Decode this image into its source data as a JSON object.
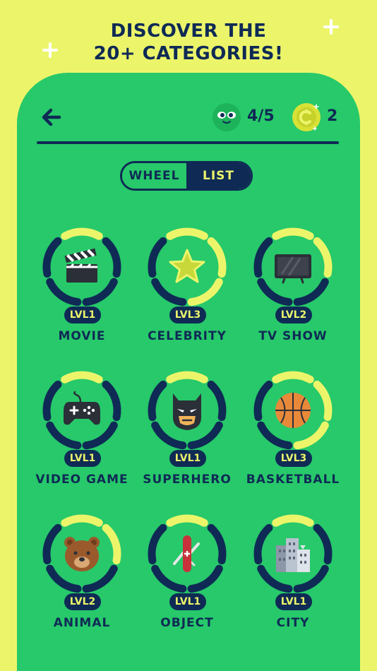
{
  "headline": {
    "line1": "DISCOVER THE",
    "line2": "20+ CATEGORIES!"
  },
  "header": {
    "progress": "4/5",
    "coins": "2"
  },
  "view_toggle": {
    "wheel_label": "WHEEL",
    "list_label": "LIST",
    "selected": "LIST"
  },
  "colors": {
    "background": "#ecf56a",
    "panel": "#27c96a",
    "navy": "#0f2a55",
    "ring_filled": "#ecf56a"
  },
  "categories": [
    {
      "name": "MOVIE",
      "level": "LVL1",
      "icon": "clapperboard-icon",
      "filled_segments": 1
    },
    {
      "name": "CELEBRITY",
      "level": "LVL3",
      "icon": "star-icon",
      "filled_segments": 3
    },
    {
      "name": "TV SHOW",
      "level": "LVL2",
      "icon": "tv-icon",
      "filled_segments": 2
    },
    {
      "name": "VIDEO GAME",
      "level": "LVL1",
      "icon": "gamepad-icon",
      "filled_segments": 1
    },
    {
      "name": "SUPERHERO",
      "level": "LVL1",
      "icon": "batman-mask-icon",
      "filled_segments": 1
    },
    {
      "name": "BASKETBALL",
      "level": "LVL3",
      "icon": "basketball-icon",
      "filled_segments": 3
    },
    {
      "name": "ANIMAL",
      "level": "LVL2",
      "icon": "bear-icon",
      "filled_segments": 2
    },
    {
      "name": "OBJECT",
      "level": "LVL1",
      "icon": "swiss-knife-icon",
      "filled_segments": 1
    },
    {
      "name": "CITY",
      "level": "LVL1",
      "icon": "buildings-icon",
      "filled_segments": 1
    }
  ]
}
